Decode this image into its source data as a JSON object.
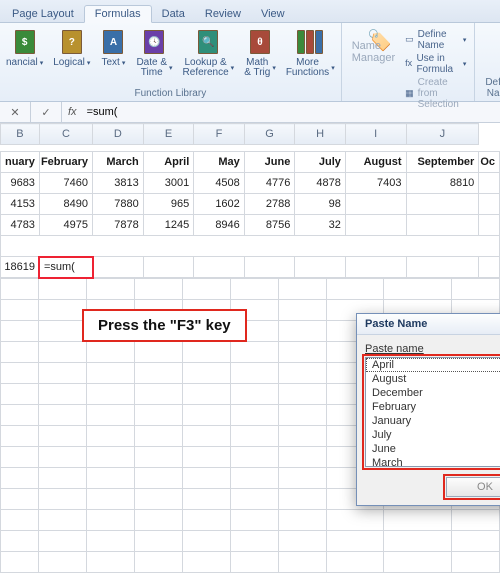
{
  "tabs": {
    "page_layout": "Page Layout",
    "formulas": "Formulas",
    "data": "Data",
    "review": "Review",
    "view": "View"
  },
  "ribbon": {
    "library_title": "Function Library",
    "btns": {
      "financial": "nancial",
      "logical": "Logical",
      "text": "Text",
      "date": "Date &\nTime",
      "lookup": "Lookup &\nReference",
      "math": "Math\n& Trig",
      "more": "More\nFunctions"
    },
    "name_mgr": "Name\nManager",
    "defined": {
      "title": "Defined Names",
      "define": "Define Name",
      "use": "Use in Formula",
      "create": "Create from Selection"
    }
  },
  "formula_bar": {
    "cancel": "✕",
    "accept": "✓",
    "fx": "fx",
    "value": "=sum("
  },
  "cols": [
    "B",
    "C",
    "D",
    "E",
    "F",
    "G",
    "H",
    "I",
    "J"
  ],
  "headers": [
    "nuary",
    "February",
    "March",
    "April",
    "May",
    "June",
    "July",
    "August",
    "September",
    "Oc"
  ],
  "rows": [
    [
      "9683",
      "7460",
      "3813",
      "3001",
      "4508",
      "4776",
      "4878",
      "7403",
      "8810",
      ""
    ],
    [
      "4153",
      "8490",
      "7880",
      "965",
      "1602",
      "2788",
      "98",
      "",
      "",
      ""
    ],
    [
      "4783",
      "4975",
      "7878",
      "1245",
      "8946",
      "8756",
      "32",
      "",
      "",
      ""
    ]
  ],
  "sum_row": {
    "a": "18619",
    "b": "=sum("
  },
  "instruction": "Press the \"F3\" key",
  "dialog": {
    "title": "Paste Name",
    "label": "Paste name",
    "items": [
      "April",
      "August",
      "December",
      "February",
      "January",
      "July",
      "June",
      "March"
    ],
    "ok": "OK"
  }
}
